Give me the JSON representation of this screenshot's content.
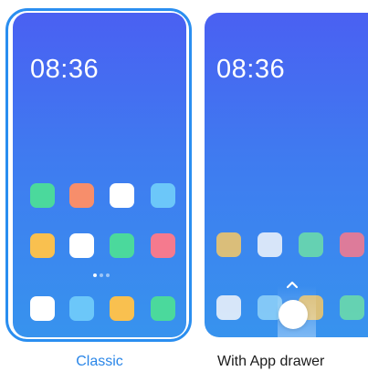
{
  "options": [
    {
      "id": "classic",
      "label": "Classic",
      "selected": true,
      "clock": "08:36",
      "icon_rows": [
        [
          "#4bd99c",
          "#f78e6b",
          "#ffffff",
          "#6cc7f9"
        ],
        [
          "#f9c04f",
          "#ffffff",
          "#4bd99c",
          "#f57a8e"
        ],
        [
          "#ffffff",
          "#6cc7f9",
          "#f9c04f",
          "#4bd99c"
        ]
      ],
      "page_indicator": {
        "count": 3,
        "active": 0
      }
    },
    {
      "id": "app_drawer",
      "label": "With App drawer",
      "selected": false,
      "clock": "08:36",
      "icon_rows": [
        [
          "#f0c66a",
          "#edf2fb",
          "#6bdcaa",
          "#f47a8e"
        ],
        [
          "#edf2fb",
          "#8dd0f8",
          "#f0c66a",
          "#6bdcaa"
        ]
      ],
      "swipe_hint": "chevron-up"
    }
  ],
  "colors": {
    "accent": "#2a8ef0",
    "wallpaper_top": "#4a60f2",
    "wallpaper_bottom": "#3793ee",
    "caption_selected": "#2a86e8",
    "caption_default": "#1b1b1b"
  }
}
